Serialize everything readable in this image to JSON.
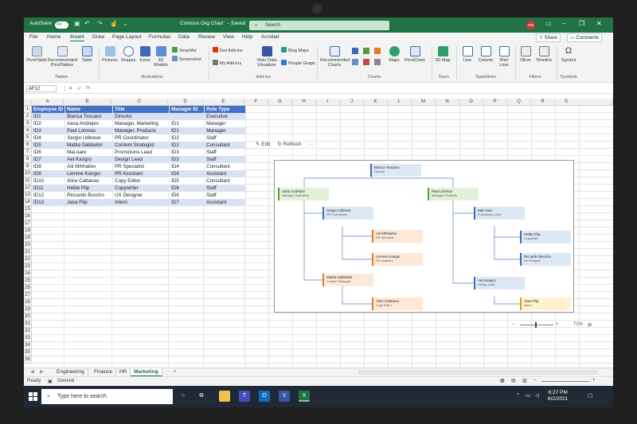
{
  "titlebar": {
    "autosave_label": "AutoSave",
    "autosave_state": "On",
    "doc_title": "Contoso Org Chart",
    "save_status": "Saved",
    "search_placeholder": "Search",
    "user_initials": "HM"
  },
  "menu": {
    "tabs": [
      "File",
      "Home",
      "Insert",
      "Draw",
      "Page Layout",
      "Formulas",
      "Data",
      "Review",
      "View",
      "Help",
      "Acrobat"
    ],
    "active": "Insert",
    "share": "Share",
    "comments": "Comments"
  },
  "ribbon": {
    "pivottable": "PivotTable",
    "recommended_pivottables": "Recommended PivotTables",
    "table": "Table",
    "pictures": "Pictures",
    "shapes": "Shapes",
    "icons": "Icons",
    "models_3d": "3D Models",
    "smartart": "SmartArt",
    "screenshot": "Screenshot",
    "get_addins": "Get Add-ins",
    "my_addins": "My Add-ins",
    "visio": "Visio Data Visualizer",
    "bing_maps": "Bing Maps",
    "people_graph": "People Graph",
    "recommended_charts": "Recommended Charts",
    "maps": "Maps",
    "pivotchart": "PivotChart",
    "map_3d": "3D Map",
    "line": "Line",
    "column": "Column",
    "winloss": "Win/ Loss",
    "slicer": "Slicer",
    "timeline": "Timeline",
    "symbol": "Symbol",
    "groups": {
      "tables": "Tables",
      "illustrations": "Illustrations",
      "addins": "Add-ins",
      "charts": "Charts",
      "tours": "Tours",
      "sparklines": "Sparklines",
      "filters": "Filters",
      "symbols": "Symbols"
    }
  },
  "formula_bar": {
    "name_box": "AF12",
    "fx": "fx"
  },
  "columns": [
    "A",
    "B",
    "C",
    "D",
    "E",
    "F",
    "G",
    "H",
    "I",
    "J",
    "K",
    "L",
    "M",
    "N",
    "O",
    "P",
    "Q",
    "R",
    "S"
  ],
  "rows": [
    "1",
    "2",
    "3",
    "4",
    "5",
    "6",
    "7",
    "8",
    "9",
    "10",
    "11",
    "12",
    "13",
    "14",
    "15",
    "16",
    "17",
    "18",
    "19",
    "20",
    "21",
    "22",
    "23",
    "24",
    "25",
    "26",
    "27",
    "28",
    "29",
    "30",
    "31",
    "32",
    "33",
    "34",
    "35",
    "36"
  ],
  "table": {
    "headers": [
      "Employee ID",
      "Name",
      "Title",
      "Manager ID",
      "Role Type"
    ],
    "rows": [
      [
        "ID1",
        "Bianca Toscano",
        "Director",
        "",
        "Executive"
      ],
      [
        "ID2",
        "Aasa Andrejev",
        "Manager, Marketing",
        "ID1",
        "Manager"
      ],
      [
        "ID3",
        "Paul Lohmus",
        "Manager, Products",
        "ID1",
        "Manager"
      ],
      [
        "ID4",
        "Sergio Udinese",
        "PR Coordinator",
        "ID2",
        "Staff"
      ],
      [
        "ID5",
        "Mattia Sabbatini",
        "Content Strategist",
        "ID2",
        "Consultant"
      ],
      [
        "ID6",
        "Mai Aare",
        "Promotions Lead",
        "ID3",
        "Staff"
      ],
      [
        "ID7",
        "Aet Kangro",
        "Design Lead",
        "ID3",
        "Staff"
      ],
      [
        "ID8",
        "Aili Mihhailov",
        "PR Specialist",
        "ID4",
        "Consultant"
      ],
      [
        "ID9",
        "Lemme Kangur",
        "PR Assistant",
        "ID4",
        "Assistant"
      ],
      [
        "ID10",
        "Alice Cattaneo",
        "Copy Editor",
        "ID5",
        "Consultant"
      ],
      [
        "ID11",
        "Heibe Piip",
        "Copywriter",
        "ID6",
        "Staff"
      ],
      [
        "ID12",
        "Riccardo Buccho",
        "UX Designer",
        "ID6",
        "Staff"
      ],
      [
        "ID13",
        "Jana Piip",
        "Intern",
        "ID7",
        "Assistant"
      ]
    ]
  },
  "org_panel": {
    "edit": "Edit",
    "refresh": "Refresh",
    "more": "···",
    "zoom": "72%",
    "nodes": {
      "n1": {
        "name": "Bianca Toscano",
        "title": "Director"
      },
      "n2": {
        "name": "Aasa Andrejev",
        "title": "Manager, Marketing"
      },
      "n3": {
        "name": "Paul Lohmus",
        "title": "Manager, Products"
      },
      "n4": {
        "name": "Sergio Udinese",
        "title": "PR Coordinator"
      },
      "n5": {
        "name": "Aili Mihhailov",
        "title": "PR Specialist"
      },
      "n6": {
        "name": "Lemme Kangur",
        "title": "PR Assistant"
      },
      "n7": {
        "name": "Mattia Sabbatini",
        "title": "Content Strategist"
      },
      "n8": {
        "name": "Alice Cattaneo",
        "title": "Copy Editor"
      },
      "n9": {
        "name": "Mai Aare",
        "title": "Promotions Lead"
      },
      "n10": {
        "name": "Heibe Piip",
        "title": "Copywriter"
      },
      "n11": {
        "name": "Riccardo Buccho",
        "title": "UX Designer"
      },
      "n12": {
        "name": "Aet Kangro",
        "title": "Design Lead"
      },
      "n13": {
        "name": "Jana Piip",
        "title": "Intern"
      }
    }
  },
  "sheets": {
    "tabs": [
      "Engineering",
      "Finance",
      "HR",
      "Marketing"
    ],
    "active": "Marketing",
    "add": "+"
  },
  "status": {
    "ready": "Ready",
    "general": "General"
  },
  "taskbar": {
    "search_placeholder": "Type here to search",
    "time": "6:27 PM",
    "date": "6/2/2021"
  },
  "colors": {
    "excel_green": "#217346",
    "table_header": "#4472c4",
    "table_band": "#d9e1f2",
    "taskbar": "#1f2a36"
  }
}
